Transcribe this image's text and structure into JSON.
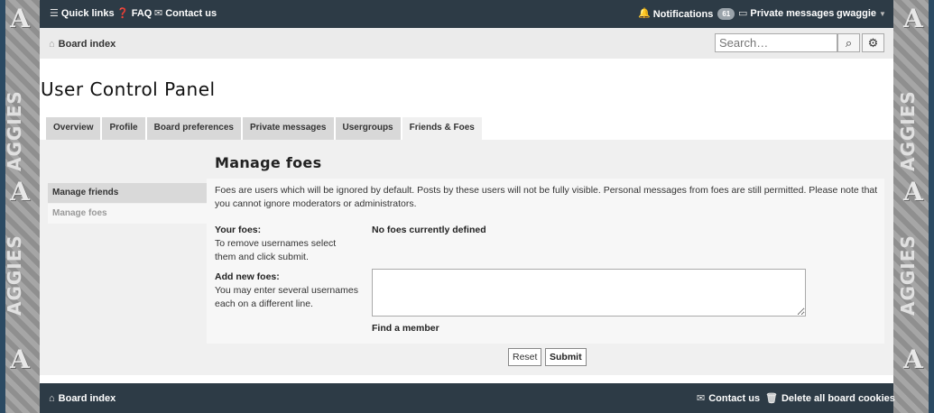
{
  "topbar": {
    "quick_links": "Quick links",
    "faq": "FAQ",
    "contact": "Contact us",
    "notifications": "Notifications",
    "notifications_count": "61",
    "private_messages": "Private messages",
    "username": "gwaggie"
  },
  "navbar": {
    "breadcrumb": "Board index",
    "search_placeholder": "Search…"
  },
  "page": {
    "title": "User Control Panel",
    "tabs": [
      {
        "label": "Overview"
      },
      {
        "label": "Profile"
      },
      {
        "label": "Board preferences"
      },
      {
        "label": "Private messages"
      },
      {
        "label": "Usergroups"
      },
      {
        "label": "Friends & Foes"
      }
    ],
    "active_tab": "Friends & Foes",
    "side_nav": [
      {
        "label": "Manage friends"
      },
      {
        "label": "Manage foes"
      }
    ],
    "section_title": "Manage foes",
    "intro": "Foes are users which will be ignored by default. Posts by these users will not be fully visible. Personal messages from foes are still permitted. Please note that you cannot ignore moderators or administrators.",
    "your_foes_label": "Your foes:",
    "your_foes_help": "To remove usernames select them and click submit.",
    "your_foes_value": "No foes currently defined",
    "add_foes_label": "Add new foes:",
    "add_foes_help": "You may enter several usernames each on a different line.",
    "find_member": "Find a member",
    "reset_label": "Reset",
    "submit_label": "Submit"
  },
  "footer": {
    "breadcrumb": "Board index",
    "contact": "Contact us",
    "delete_cookies": "Delete all board cookies"
  },
  "decor": {
    "side_letter": "A",
    "side_word": "AGGIES"
  },
  "colors": {
    "topbar_bg": "#2d3b46",
    "panel_bg": "#f0f0f0",
    "tab_bg": "#d8d8d8"
  }
}
